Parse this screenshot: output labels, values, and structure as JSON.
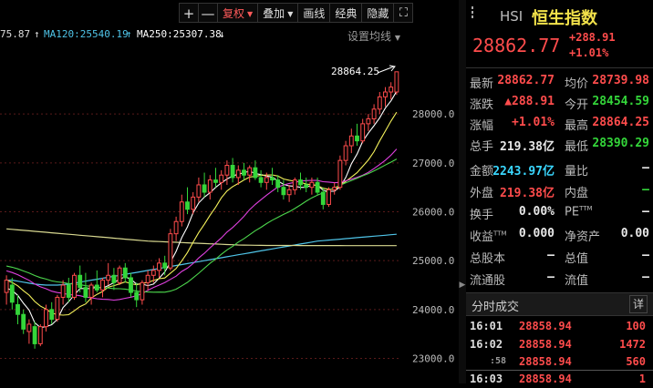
{
  "toolbar": {
    "plus": "+",
    "minus": "—",
    "fuquan": "复权",
    "diejia": "叠加",
    "huaxian": "画线",
    "jingdian": "经典",
    "yincang": "隐藏",
    "fullscreen": "⛶"
  },
  "ma_row": {
    "ma60_partial": "75.87",
    "ma120": "MA120:25540.19",
    "ma250": "MA250:25307.38",
    "settings": "设置均线"
  },
  "axis": {
    "ticks": [
      {
        "label": "28000.0",
        "value": 28000
      },
      {
        "label": "27000.0",
        "value": 27000
      },
      {
        "label": "26000.0",
        "value": 26000
      },
      {
        "label": "25000.0",
        "value": 25000
      },
      {
        "label": "24000.0",
        "value": 24000
      },
      {
        "label": "23000.0",
        "value": 23000
      }
    ]
  },
  "high_annotation": "28864.25",
  "header": {
    "code": "HSI",
    "name": "恒生指数",
    "price": "28862.77",
    "change": "+288.91",
    "change_pct": "+1.01%"
  },
  "stats": {
    "latest_label": "最新",
    "latest": "28862.77",
    "avg_label": "均价",
    "avg": "28739.98",
    "chg_label": "涨跌",
    "chg": "▲288.91",
    "open_label": "今开",
    "open": "28454.59",
    "pct_label": "涨幅",
    "pct": "+1.01%",
    "high_label": "最高",
    "high": "28864.25",
    "vol_label": "总手",
    "vol": "219.38亿",
    "low_label": "最低",
    "low": "28390.29",
    "amount_label": "金额",
    "amount": "2243.97亿",
    "ratio_label": "量比",
    "ratio": "—",
    "outer_label": "外盘",
    "outer": "219.38亿",
    "inner_label": "内盘",
    "inner": "—",
    "turnover_label": "换手",
    "turnover": "0.00%",
    "pe_label": "PE",
    "pe_sup": "TTM",
    "pe": "—",
    "eps_label": "收益",
    "eps_sup": "TTM",
    "eps": "0.000",
    "bvps_label": "净资产",
    "bvps": "0.00",
    "total_shares_label": "总股本",
    "total_shares": "—",
    "total_value_label": "总值",
    "total_value": "—",
    "float_shares_label": "流通股",
    "float_shares": "—",
    "float_value_label": "流值",
    "float_value": "—"
  },
  "trades": {
    "title": "分时成交",
    "detail": "详",
    "rows": [
      {
        "time": "16:01",
        "price": "28858.94",
        "vol": "100"
      },
      {
        "time": "16:02",
        "price": "28858.94",
        "vol": "1472"
      },
      {
        "time": ":58",
        "price": "28858.94",
        "vol": "560"
      },
      {
        "time": "16:03",
        "price": "28858.94",
        "vol": "1"
      }
    ]
  },
  "colors": {
    "up": "#ff4c4c",
    "down": "#34d63a",
    "cyan": "#3ad7ff",
    "yellow": "#f2e24a",
    "ma5": "#ffffff",
    "ma10": "#f5f25b",
    "ma20": "#e040e0",
    "ma30": "#4cd64c",
    "ma60": "#dddddd",
    "ma120": "#4fc4e8",
    "ma250": "#d8d890"
  },
  "chart_data": {
    "type": "candlestick",
    "ylim": [
      22600,
      29400
    ],
    "candles": [
      {
        "o": 24350,
        "h": 24700,
        "l": 24100,
        "c": 24600
      },
      {
        "o": 24500,
        "h": 24650,
        "l": 24000,
        "c": 24150
      },
      {
        "o": 24100,
        "h": 24300,
        "l": 23700,
        "c": 23900
      },
      {
        "o": 23900,
        "h": 24000,
        "l": 23500,
        "c": 23600
      },
      {
        "o": 23550,
        "h": 23800,
        "l": 23300,
        "c": 23700
      },
      {
        "o": 23650,
        "h": 23750,
        "l": 23200,
        "c": 23300
      },
      {
        "o": 23300,
        "h": 23700,
        "l": 23250,
        "c": 23650
      },
      {
        "o": 23650,
        "h": 24100,
        "l": 23550,
        "c": 24000
      },
      {
        "o": 24000,
        "h": 24150,
        "l": 23700,
        "c": 23800
      },
      {
        "o": 23800,
        "h": 24300,
        "l": 23750,
        "c": 24250
      },
      {
        "o": 24250,
        "h": 24600,
        "l": 24100,
        "c": 24500
      },
      {
        "o": 24500,
        "h": 24650,
        "l": 24150,
        "c": 24250
      },
      {
        "o": 24250,
        "h": 24750,
        "l": 24200,
        "c": 24700
      },
      {
        "o": 24700,
        "h": 24900,
        "l": 24350,
        "c": 24450
      },
      {
        "o": 24450,
        "h": 24750,
        "l": 24150,
        "c": 24250
      },
      {
        "o": 24250,
        "h": 24550,
        "l": 24100,
        "c": 24500
      },
      {
        "o": 24500,
        "h": 24800,
        "l": 24350,
        "c": 24400
      },
      {
        "o": 24400,
        "h": 24650,
        "l": 24250,
        "c": 24600
      },
      {
        "o": 24600,
        "h": 24950,
        "l": 24500,
        "c": 24700
      },
      {
        "o": 24700,
        "h": 24850,
        "l": 24400,
        "c": 24550
      },
      {
        "o": 24550,
        "h": 24900,
        "l": 24500,
        "c": 24850
      },
      {
        "o": 24850,
        "h": 24950,
        "l": 24550,
        "c": 24650
      },
      {
        "o": 24650,
        "h": 24750,
        "l": 24250,
        "c": 24350
      },
      {
        "o": 24350,
        "h": 24550,
        "l": 24050,
        "c": 24200
      },
      {
        "o": 24200,
        "h": 24600,
        "l": 24100,
        "c": 24550
      },
      {
        "o": 24550,
        "h": 24800,
        "l": 24400,
        "c": 24700
      },
      {
        "o": 24700,
        "h": 24900,
        "l": 24550,
        "c": 24800
      },
      {
        "o": 24800,
        "h": 25050,
        "l": 24650,
        "c": 24950
      },
      {
        "o": 24950,
        "h": 25100,
        "l": 24700,
        "c": 24850
      },
      {
        "o": 24850,
        "h": 25650,
        "l": 24800,
        "c": 25550
      },
      {
        "o": 25550,
        "h": 25900,
        "l": 25400,
        "c": 25800
      },
      {
        "o": 25800,
        "h": 26350,
        "l": 25700,
        "c": 26200
      },
      {
        "o": 26200,
        "h": 26500,
        "l": 25950,
        "c": 26050
      },
      {
        "o": 26050,
        "h": 26400,
        "l": 25950,
        "c": 26300
      },
      {
        "o": 26300,
        "h": 26700,
        "l": 26200,
        "c": 26550
      },
      {
        "o": 26550,
        "h": 26800,
        "l": 26300,
        "c": 26400
      },
      {
        "o": 26400,
        "h": 26750,
        "l": 26250,
        "c": 26650
      },
      {
        "o": 26650,
        "h": 26900,
        "l": 26500,
        "c": 26600
      },
      {
        "o": 26600,
        "h": 26850,
        "l": 26450,
        "c": 26750
      },
      {
        "o": 26750,
        "h": 27050,
        "l": 26550,
        "c": 26950
      },
      {
        "o": 26950,
        "h": 27100,
        "l": 26600,
        "c": 26700
      },
      {
        "o": 26700,
        "h": 26950,
        "l": 26550,
        "c": 26850
      },
      {
        "o": 26850,
        "h": 27000,
        "l": 26650,
        "c": 26750
      },
      {
        "o": 26750,
        "h": 26950,
        "l": 26600,
        "c": 26900
      },
      {
        "o": 26900,
        "h": 27050,
        "l": 26650,
        "c": 26700
      },
      {
        "o": 26700,
        "h": 26850,
        "l": 26500,
        "c": 26600
      },
      {
        "o": 26600,
        "h": 26800,
        "l": 26450,
        "c": 26700
      },
      {
        "o": 26700,
        "h": 26900,
        "l": 26550,
        "c": 26650
      },
      {
        "o": 26650,
        "h": 26750,
        "l": 26400,
        "c": 26500
      },
      {
        "o": 26500,
        "h": 26650,
        "l": 26250,
        "c": 26350
      },
      {
        "o": 26350,
        "h": 26550,
        "l": 26200,
        "c": 26450
      },
      {
        "o": 26450,
        "h": 26700,
        "l": 26350,
        "c": 26650
      },
      {
        "o": 26650,
        "h": 26800,
        "l": 26450,
        "c": 26550
      },
      {
        "o": 26550,
        "h": 26700,
        "l": 26400,
        "c": 26500
      },
      {
        "o": 26500,
        "h": 26700,
        "l": 26350,
        "c": 26600
      },
      {
        "o": 26600,
        "h": 26700,
        "l": 26350,
        "c": 26400
      },
      {
        "o": 26400,
        "h": 26500,
        "l": 26050,
        "c": 26150
      },
      {
        "o": 26150,
        "h": 26500,
        "l": 26100,
        "c": 26450
      },
      {
        "o": 26450,
        "h": 26600,
        "l": 26350,
        "c": 26500
      },
      {
        "o": 26500,
        "h": 27150,
        "l": 26450,
        "c": 27050
      },
      {
        "o": 27050,
        "h": 27450,
        "l": 26950,
        "c": 27350
      },
      {
        "o": 27350,
        "h": 27700,
        "l": 27200,
        "c": 27550
      },
      {
        "o": 27550,
        "h": 27800,
        "l": 27350,
        "c": 27450
      },
      {
        "o": 27450,
        "h": 27900,
        "l": 27400,
        "c": 27800
      },
      {
        "o": 27800,
        "h": 28000,
        "l": 27650,
        "c": 27900
      },
      {
        "o": 27900,
        "h": 28200,
        "l": 27800,
        "c": 28100
      },
      {
        "o": 28100,
        "h": 28450,
        "l": 28000,
        "c": 28350
      },
      {
        "o": 28350,
        "h": 28550,
        "l": 28150,
        "c": 28450
      },
      {
        "o": 28450,
        "h": 28650,
        "l": 28300,
        "c": 28550
      },
      {
        "o": 28450,
        "h": 28864.25,
        "l": 28390.29,
        "c": 28862.77
      }
    ],
    "ma_lines": [
      {
        "name": "MA120",
        "color": "#4fc4e8",
        "y": [
          24600,
          24600,
          24580,
          24560,
          24540,
          24520,
          24510,
          24500,
          24500,
          24500,
          24510,
          24520,
          24540,
          24560,
          24580,
          24600,
          24620,
          24640,
          24660,
          24680,
          24700,
          24720,
          24740,
          24760,
          24780,
          24800,
          24820,
          24840,
          24860,
          24880,
          24900,
          24920,
          24940,
          24960,
          24980,
          25000,
          25020,
          25040,
          25060,
          25080,
          25100,
          25120,
          25140,
          25160,
          25180,
          25200,
          25220,
          25240,
          25260,
          25280,
          25300,
          25320,
          25340,
          25360,
          25380,
          25400,
          25410,
          25420,
          25430,
          25440,
          25450,
          25460,
          25470,
          25480,
          25490,
          25500,
          25510,
          25520,
          25530,
          25540
        ]
      },
      {
        "name": "MA250",
        "color": "#d8d890",
        "y": [
          25650,
          25640,
          25630,
          25620,
          25610,
          25600,
          25590,
          25580,
          25570,
          25560,
          25550,
          25540,
          25530,
          25520,
          25510,
          25500,
          25490,
          25480,
          25470,
          25460,
          25450,
          25440,
          25430,
          25420,
          25410,
          25400,
          25395,
          25390,
          25385,
          25380,
          25375,
          25370,
          25365,
          25360,
          25355,
          25350,
          25345,
          25340,
          25335,
          25330,
          25325,
          25320,
          25318,
          25316,
          25314,
          25312,
          25310,
          25310,
          25310,
          25310,
          25310,
          25310,
          25309,
          25309,
          25309,
          25308,
          25308,
          25308,
          25308,
          25308,
          25307,
          25307,
          25307,
          25307,
          25307,
          25307,
          25307,
          25307,
          25307,
          25307
        ]
      }
    ]
  }
}
